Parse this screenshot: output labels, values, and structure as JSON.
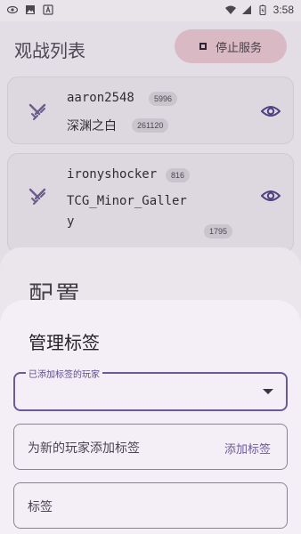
{
  "status_bar": {
    "time": "3:58"
  },
  "app": {
    "title": "观战列表",
    "stop_button": "停止服务",
    "players": [
      {
        "name": "aaron2548",
        "id": "5996",
        "deck": "深渊之白",
        "deck_id": "261120"
      },
      {
        "name": "ironyshocker",
        "id": "816",
        "deck_line1": "TCG_Minor_Galler",
        "deck_line2": "y",
        "deck_id": "1795"
      }
    ]
  },
  "config_sheet": {
    "title": "配置"
  },
  "dialog": {
    "title": "管理标签",
    "dropdown_label": "已添加标签的玩家",
    "dropdown_value": "",
    "add_tag_placeholder": "为新的玩家添加标签",
    "add_tag_button": "添加标签",
    "tag_placeholder": "标签"
  },
  "colors": {
    "accent": "#6b5a95",
    "stop_button_bg": "#d9b9c3",
    "dialog_bg": "#f4eef6"
  }
}
